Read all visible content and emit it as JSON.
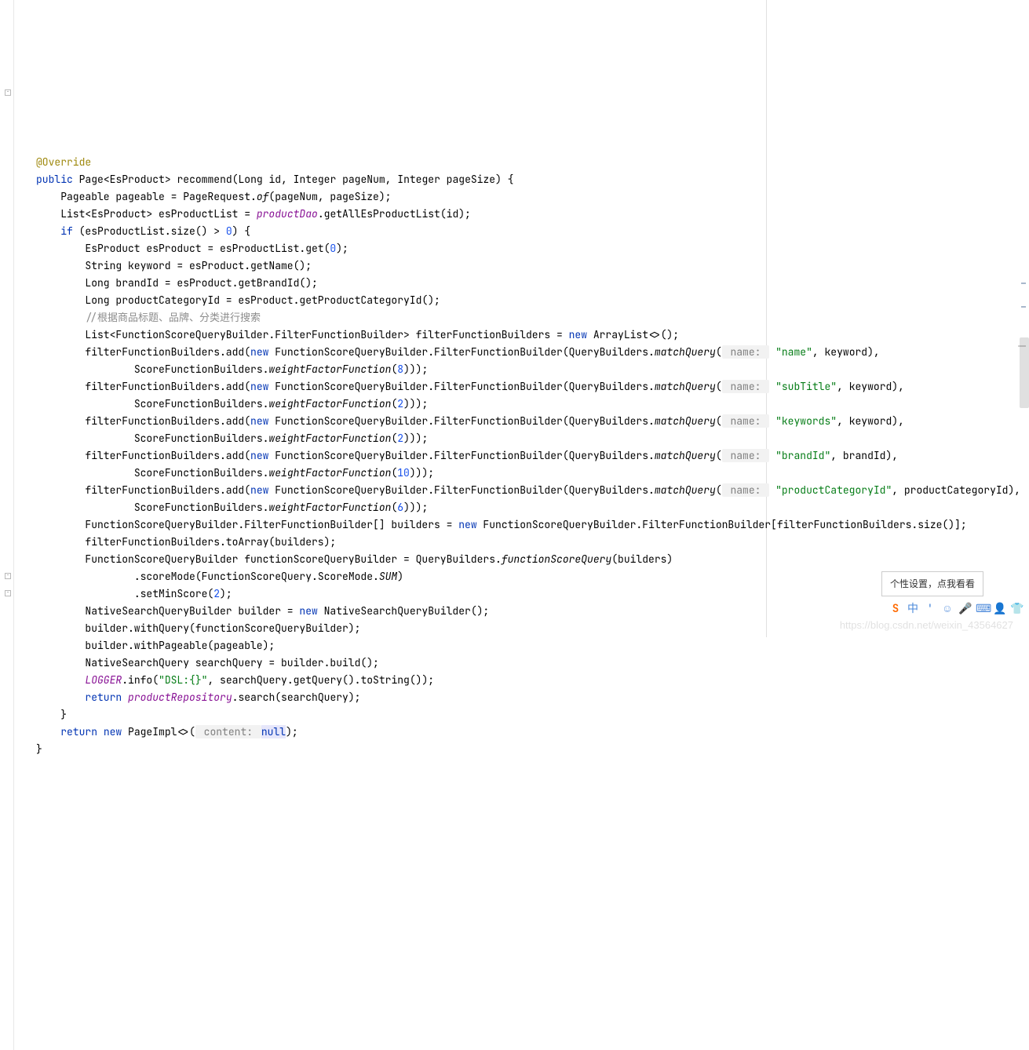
{
  "annotation": "@Override",
  "sig": {
    "public": "public",
    "ret_pre": "Page<",
    "ret_cls": "EsProduct",
    "ret_post": ">",
    "name": "recommend",
    "params": "(Long id, Integer pageNum, Integer pageSize) {"
  },
  "l1": {
    "a": "Pageable pageable = PageRequest.",
    "of": "of",
    "b": "(pageNum, pageSize);"
  },
  "l2": {
    "a": "List<",
    "cls": "EsProduct",
    "b": "> esProductList = ",
    "dao": "productDao",
    "c": ".getAllEsProductList(id);"
  },
  "l3": {
    "if": "if",
    "a": " (esProductList.size() > ",
    "n": "0",
    "b": ") {"
  },
  "l4": {
    "a": "EsProduct esProduct = esProductList.get(",
    "n": "0",
    "b": ");"
  },
  "l5": "String keyword = esProduct.getName();",
  "l6": "Long brandId = esProduct.getBrandId();",
  "l7": "Long productCategoryId = esProduct.getProductCategoryId();",
  "l8": "//根据商品标题、品牌、分类进行搜索",
  "l9": {
    "a": "List<FunctionScoreQueryBuilder.FilterFunctionBuilder> filterFunctionBuilders = ",
    "new": "new",
    "b": " ArrayList<>();"
  },
  "ff": [
    {
      "a": "filterFunctionBuilders.add(",
      "new": "new",
      "b": " FunctionScoreQueryBuilder.FilterFunctionBuilder(QueryBuilders.",
      "mq": "matchQuery",
      "c": "(",
      "pn": " name: ",
      "str": "\"name\"",
      "d": ", keyword),",
      "wa": "ScoreFunctionBuilders.",
      "wf": "weightFactorFunction",
      "we": "(",
      "wn": "8",
      "wz": ")));"
    },
    {
      "a": "filterFunctionBuilders.add(",
      "new": "new",
      "b": " FunctionScoreQueryBuilder.FilterFunctionBuilder(QueryBuilders.",
      "mq": "matchQuery",
      "c": "(",
      "pn": " name: ",
      "str": "\"subTitle\"",
      "d": ", keyword),",
      "wa": "ScoreFunctionBuilders.",
      "wf": "weightFactorFunction",
      "we": "(",
      "wn": "2",
      "wz": ")));"
    },
    {
      "a": "filterFunctionBuilders.add(",
      "new": "new",
      "b": " FunctionScoreQueryBuilder.FilterFunctionBuilder(QueryBuilders.",
      "mq": "matchQuery",
      "c": "(",
      "pn": " name: ",
      "str": "\"keywords\"",
      "d": ", keyword),",
      "wa": "ScoreFunctionBuilders.",
      "wf": "weightFactorFunction",
      "we": "(",
      "wn": "2",
      "wz": ")));"
    },
    {
      "a": "filterFunctionBuilders.add(",
      "new": "new",
      "b": " FunctionScoreQueryBuilder.FilterFunctionBuilder(QueryBuilders.",
      "mq": "matchQuery",
      "c": "(",
      "pn": " name: ",
      "str": "\"brandId\"",
      "d": ", brandId),",
      "wa": "ScoreFunctionBuilders.",
      "wf": "weightFactorFunction",
      "we": "(",
      "wn": "10",
      "wz": ")));"
    },
    {
      "a": "filterFunctionBuilders.add(",
      "new": "new",
      "b": " FunctionScoreQueryBuilder.FilterFunctionBuilder(QueryBuilders.",
      "mq": "matchQuery",
      "c": "(",
      "pn": " name: ",
      "str": "\"productCategoryId\"",
      "d": ", productCategoryId),",
      "wa": "ScoreFunctionBuilders.",
      "wf": "weightFactorFunction",
      "we": "(",
      "wn": "6",
      "wz": ")));"
    }
  ],
  "l10": {
    "a": "FunctionScoreQueryBuilder.FilterFunctionBuilder[] builders = ",
    "new": "new",
    "b": " FunctionScoreQueryBuilder.FilterFunctionBuilder[filterFunctionBuilders.size()];"
  },
  "l11": "filterFunctionBuilders.toArray(builders);",
  "l12": {
    "a": "FunctionScoreQueryBuilder functionScoreQueryBuilder = QueryBuilders.",
    "fsq": "functionScoreQuery",
    "b": "(builders)"
  },
  "l13": {
    "a": ".scoreMode(FunctionScoreQuery.ScoreMode.",
    "sum": "SUM",
    "b": ")"
  },
  "l14": {
    "a": ".setMinScore(",
    "n": "2",
    "b": ");"
  },
  "l15": {
    "a": "NativeSearchQueryBuilder builder = ",
    "new": "new",
    "b": " NativeSearchQueryBuilder();"
  },
  "l16": "builder.withQuery(functionScoreQueryBuilder);",
  "l17": "builder.withPageable(pageable);",
  "l18": "NativeSearchQuery searchQuery = builder.build();",
  "l19": {
    "log": "LOGGER",
    "a": ".info(",
    "s": "\"DSL:{}\"",
    "b": ", searchQuery.getQuery().toString());"
  },
  "l20": {
    "ret": "return",
    "a": " ",
    "repo": "productRepository",
    "b": ".search(searchQuery);"
  },
  "l21": "}",
  "l22": {
    "ret": "return",
    "new": "new",
    "a": " PageImpl<>(",
    "pn": " content: ",
    "nul": "null",
    "b": ");"
  },
  "l23": "}",
  "popup": "个性设置，点我看看",
  "watermark": "https://blog.csdn.net/weixin_43564627",
  "ime": [
    "S",
    "中",
    "'",
    "☺",
    "🎤",
    "⌨",
    "👤",
    "👕"
  ]
}
